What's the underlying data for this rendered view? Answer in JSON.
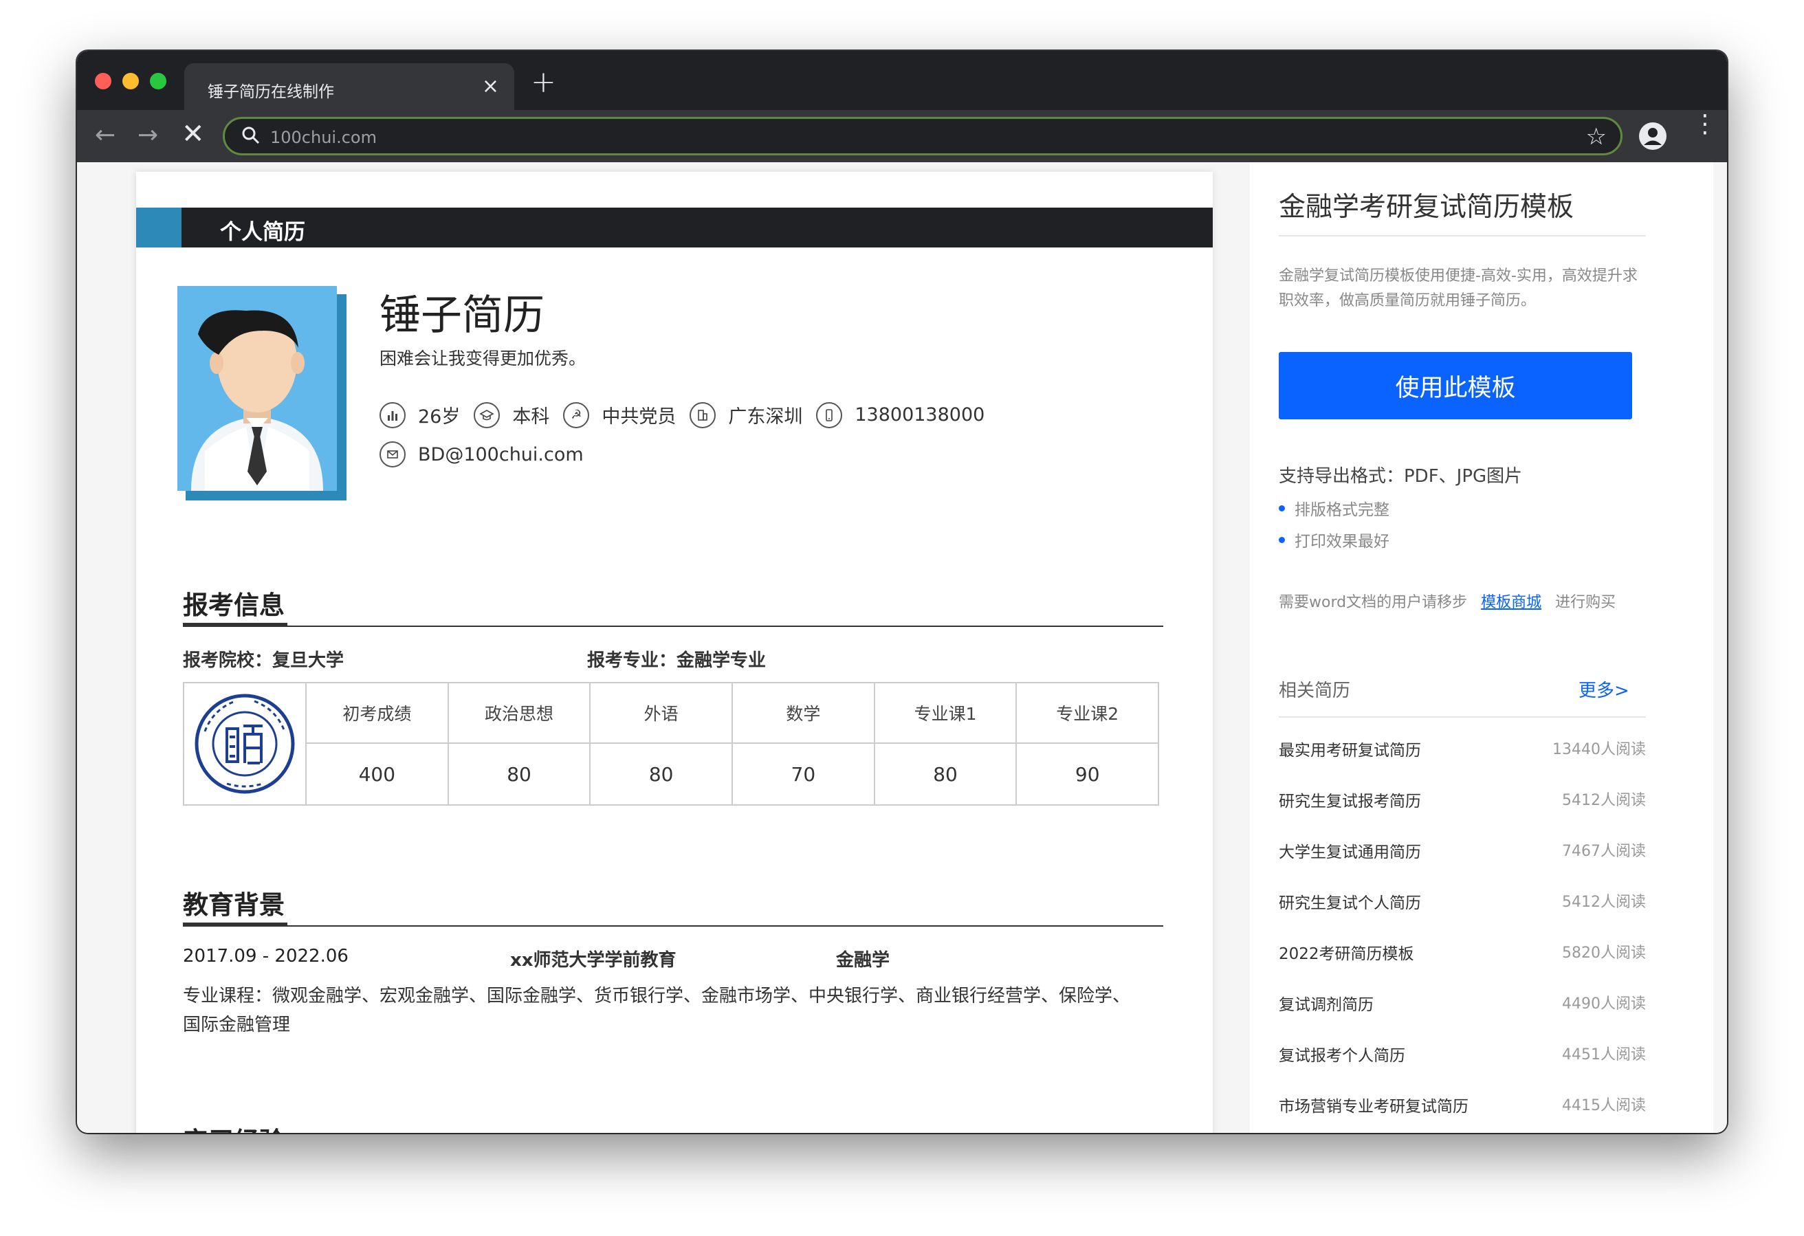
{
  "browser": {
    "tab_title": "锤子简历在线制作",
    "tab_close": "×",
    "new_tab": "+",
    "url": "100chui.com"
  },
  "resume": {
    "header_title": "个人简历",
    "name": "锤子简历",
    "motto": "困难会让我变得更加优秀。",
    "info": {
      "age": "26岁",
      "degree": "本科",
      "politics": "中共党员",
      "location": "广东深圳",
      "phone": "13800138000",
      "email": "BD@100chui.com"
    },
    "exam_section": {
      "title": "报考信息",
      "school_label": "报考院校：复旦大学",
      "major_label": "报考专业：金融学专业",
      "scores": [
        {
          "subject": "初考成绩",
          "score": "400"
        },
        {
          "subject": "政治思想",
          "score": "80"
        },
        {
          "subject": "外语",
          "score": "80"
        },
        {
          "subject": "数学",
          "score": "70"
        },
        {
          "subject": "专业课1",
          "score": "80"
        },
        {
          "subject": "专业课2",
          "score": "90"
        }
      ]
    },
    "education_section": {
      "title": "教育背景",
      "period": "2017.09 - 2022.06",
      "school": "xx师范大学学前教育",
      "major": "金融学",
      "courses_line1": "专业课程：微观金融学、宏观金融学、国际金融学、货币银行学、金融市场学、中央银行学、商业银行经营学、保险学、",
      "courses_line2": "国际金融管理"
    },
    "internship_section": {
      "title": "实习经验"
    }
  },
  "sidebar": {
    "title": "金融学考研复试简历模板",
    "desc": "金融学复试简历模板使用便捷-高效-实用，高效提升求职效率，做高质量简历就用锤子简历。",
    "use_button": "使用此模板",
    "format_label": "支持导出格式：PDF、JPG图片",
    "bullet1": "排版格式完整",
    "bullet2": "打印效果最好",
    "word_prefix": "需要word文档的用户请移步",
    "word_link": "模板商城",
    "word_suffix": "进行购买",
    "related_title": "相关简历",
    "more_link": "更多>",
    "related": [
      {
        "name": "最实用考研复试简历",
        "count": "13440人阅读"
      },
      {
        "name": "研究生复试报考简历",
        "count": "5412人阅读"
      },
      {
        "name": "大学生复试通用简历",
        "count": "7467人阅读"
      },
      {
        "name": "研究生复试个人简历",
        "count": "5412人阅读"
      },
      {
        "name": "2022考研简历模板",
        "count": "5820人阅读"
      },
      {
        "name": "复试调剂简历",
        "count": "4490人阅读"
      },
      {
        "name": "复试报考个人简历",
        "count": "4451人阅读"
      },
      {
        "name": "市场营销专业考研复试简历",
        "count": "4415人阅读"
      }
    ]
  }
}
